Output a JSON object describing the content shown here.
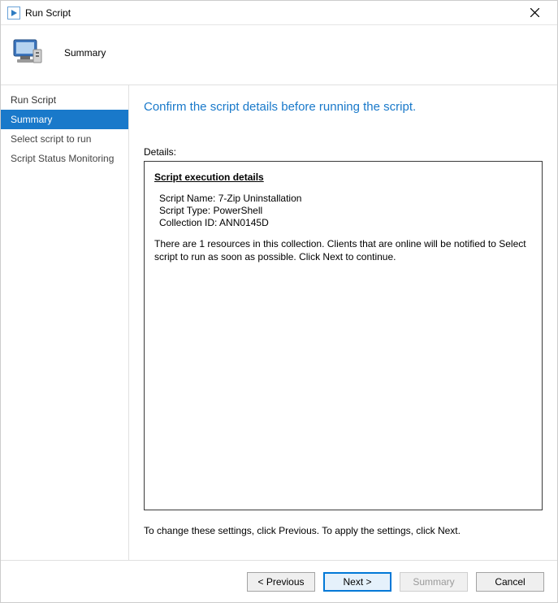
{
  "window": {
    "title": "Run Script"
  },
  "header": {
    "step_title": "Summary"
  },
  "sidebar": {
    "heading": "Run Script",
    "items": [
      {
        "label": "Summary",
        "selected": true
      },
      {
        "label": "Select script to run",
        "selected": false
      },
      {
        "label": "Script Status Monitoring",
        "selected": false
      }
    ]
  },
  "content": {
    "heading": "Confirm the script details before running the script.",
    "details_label": "Details:",
    "details_title": "Script execution details",
    "script_name_label": "Script Name:",
    "script_name_value": "7-Zip Uninstallation",
    "script_type_label": "Script Type:",
    "script_type_value": "PowerShell",
    "collection_id_label": "Collection ID:",
    "collection_id_value": "ANN0145D",
    "resource_note": "There are 1 resources in this collection. Clients that are online will be notified to Select script to run as soon as possible. Click Next to continue.",
    "hint": "To change these settings, click Previous. To apply the settings, click Next."
  },
  "footer": {
    "previous": "< Previous",
    "next": "Next >",
    "summary": "Summary",
    "cancel": "Cancel"
  }
}
